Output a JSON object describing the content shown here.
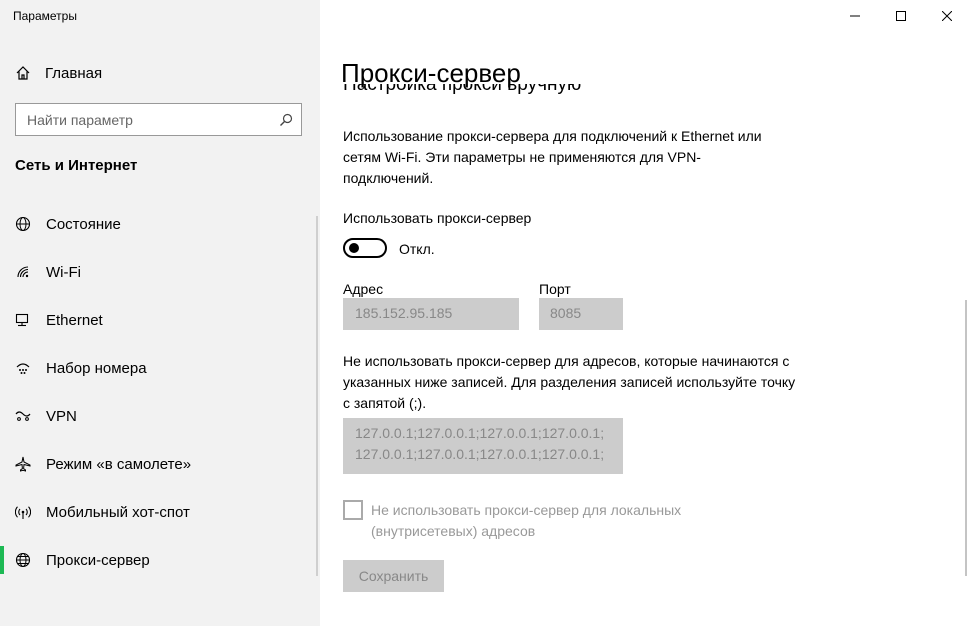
{
  "window": {
    "app_title": "Параметры"
  },
  "sidebar": {
    "home_label": "Главная",
    "search_placeholder": "Найти параметр",
    "section_title": "Сеть и Интернет",
    "items": [
      {
        "label": "Состояние",
        "icon": "globe-status-icon"
      },
      {
        "label": "Wi-Fi",
        "icon": "wifi-icon"
      },
      {
        "label": "Ethernet",
        "icon": "ethernet-icon"
      },
      {
        "label": "Набор номера",
        "icon": "dialup-icon"
      },
      {
        "label": "VPN",
        "icon": "vpn-icon"
      },
      {
        "label": "Режим «в самолете»",
        "icon": "airplane-icon"
      },
      {
        "label": "Мобильный хот-спот",
        "icon": "hotspot-icon"
      },
      {
        "label": "Прокси-сервер",
        "icon": "globe-icon",
        "selected": true
      }
    ],
    "accent_color": "#1db954"
  },
  "main": {
    "page_title": "Прокси-сервер",
    "clipped_heading": "Настройка прокси вручную",
    "description": "Использование прокси-сервера для подключений к Ethernet или сетям Wi-Fi. Эти параметры не применяются для VPN-подключений.",
    "use_proxy_label": "Использовать прокси-сервер",
    "toggle_state": "Откл.",
    "toggle_on": false,
    "address_label": "Адрес",
    "address_value": "185.152.95.185",
    "port_label": "Порт",
    "port_value": "8085",
    "exceptions_description": "Не использовать прокси-сервер для адресов, которые начинаются с указанных ниже записей. Для разделения записей используйте точку с запятой (;).",
    "exceptions_value": "127.0.0.1;127.0.0.1;127.0.0.1;127.0.0.1;127.0.0.1;127.0.0.1;127.0.0.1;127.0.0.1;",
    "local_checkbox_label": "Не использовать прокси-сервер для локальных (внутрисетевых) адресов",
    "local_checkbox_checked": false,
    "save_label": "Сохранить"
  }
}
